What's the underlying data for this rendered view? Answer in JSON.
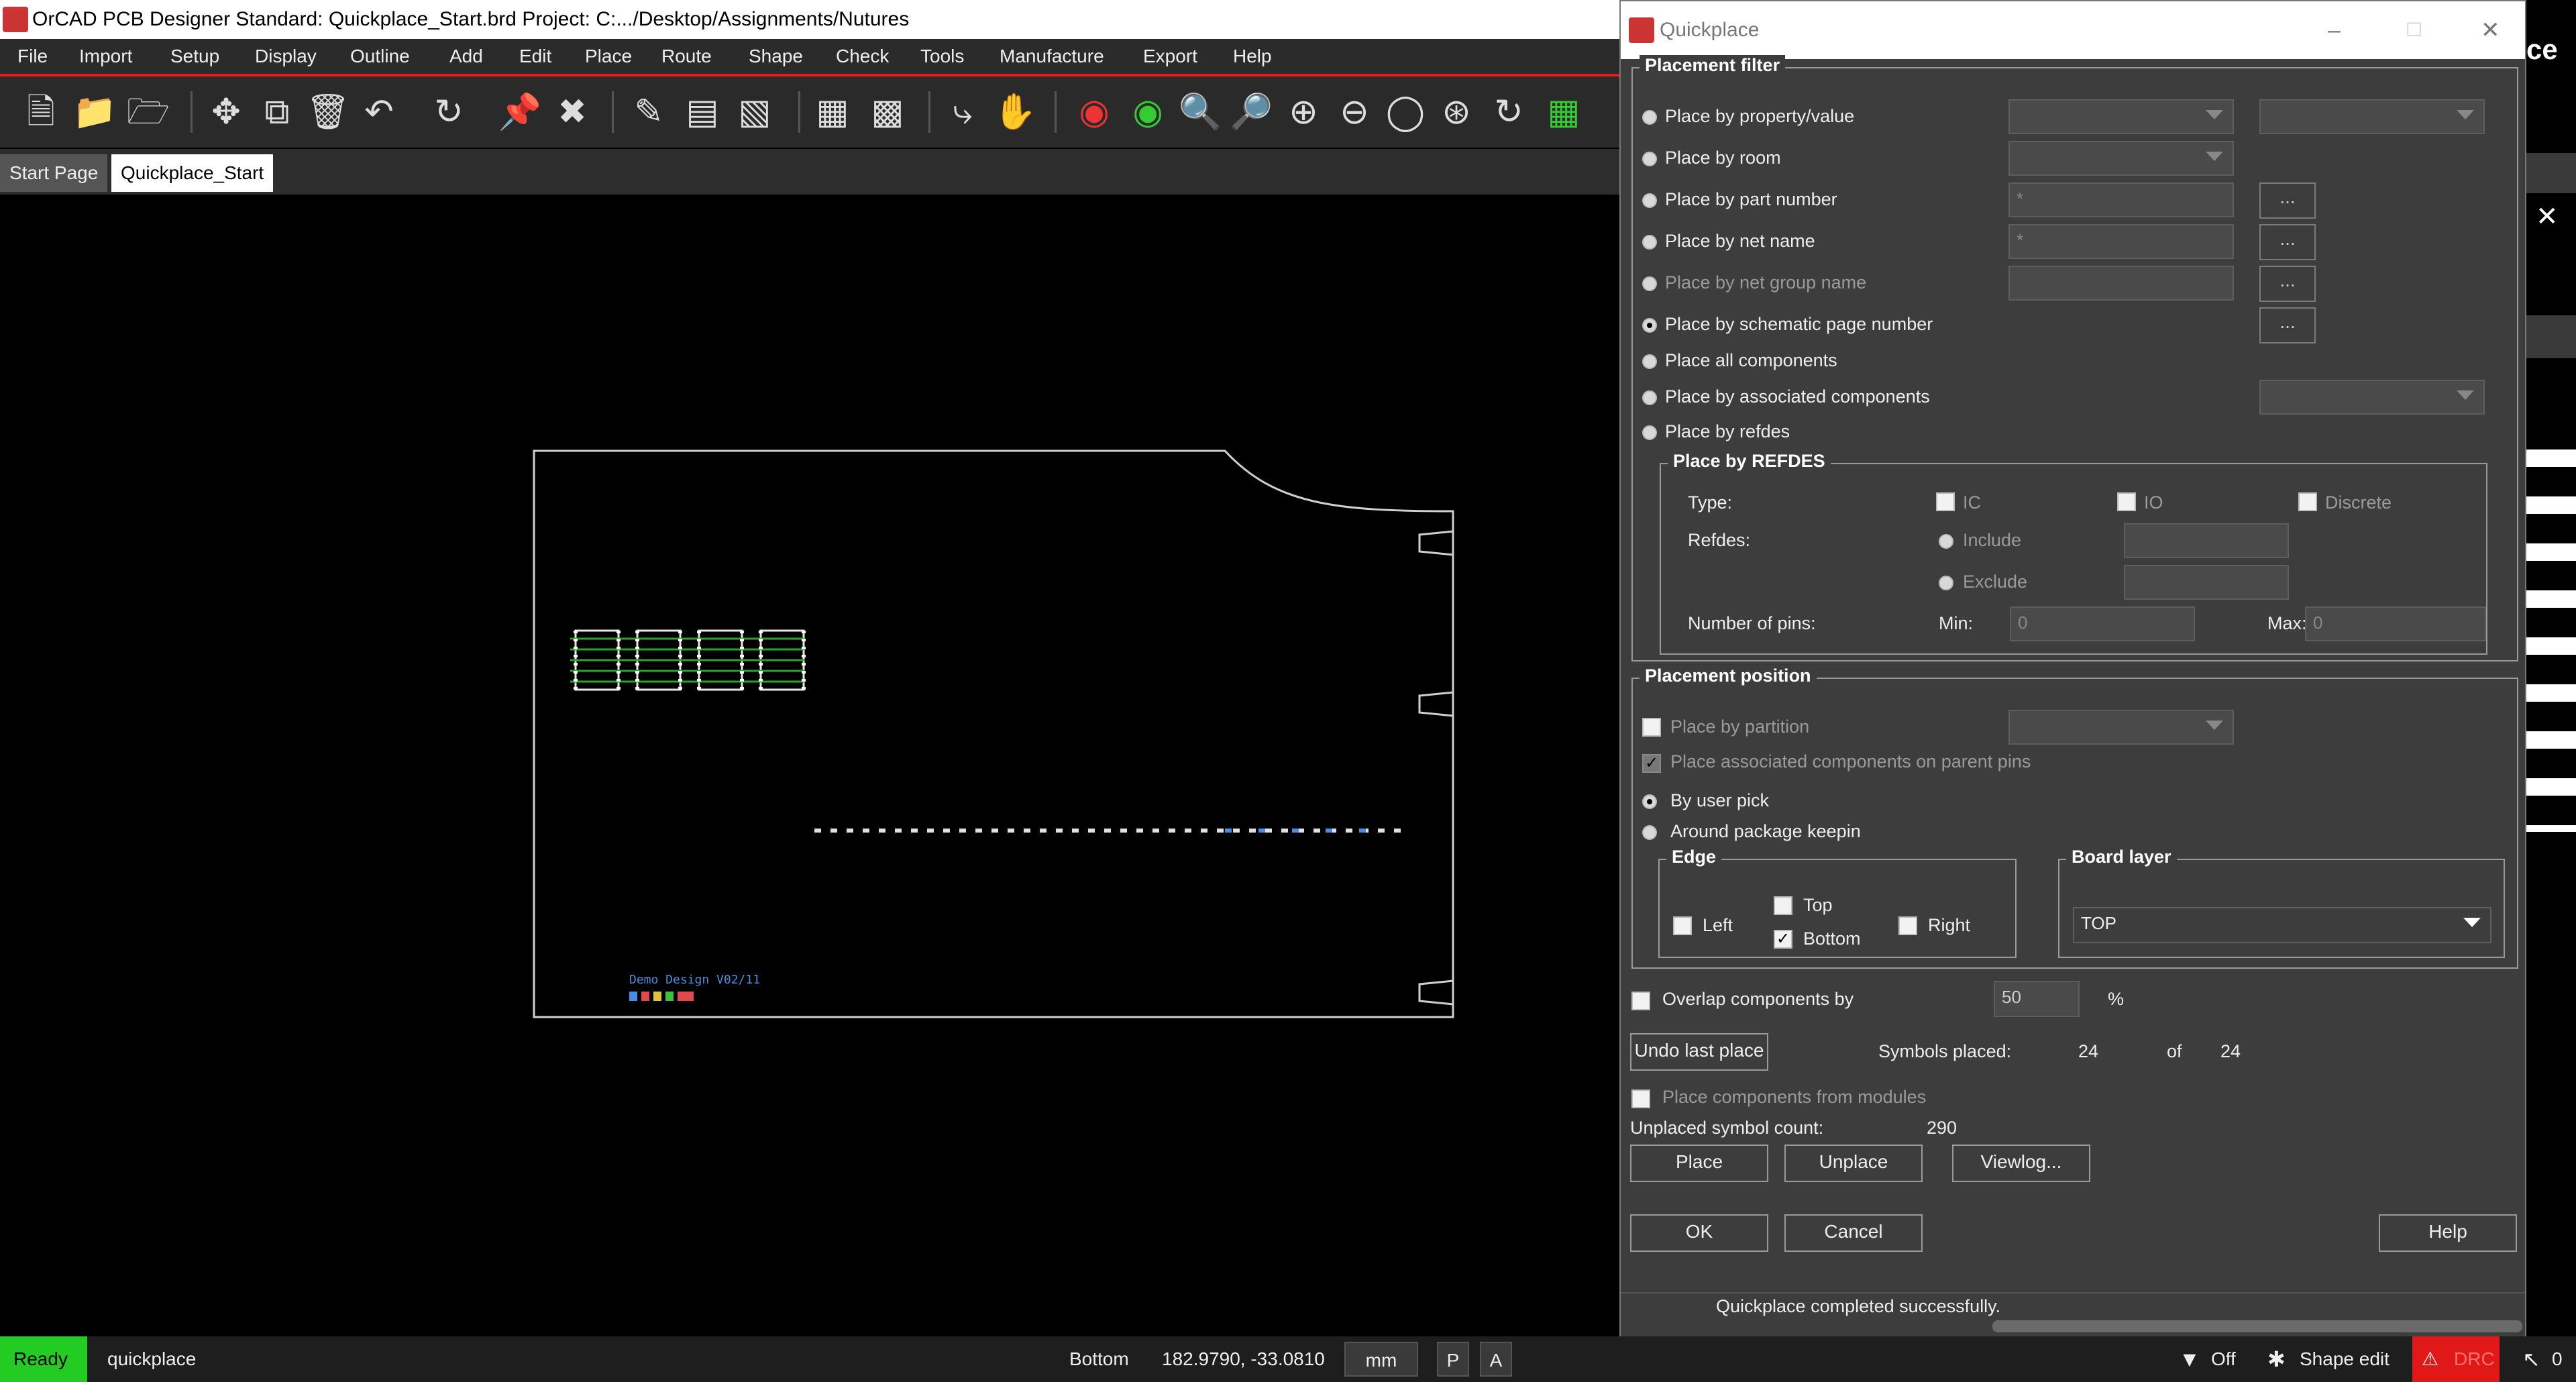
{
  "window": {
    "title": "OrCAD PCB Designer Standard: Quickplace_Start.brd  Project: C:.../Desktop/Assignments/Nutures"
  },
  "menu": [
    "File",
    "Import",
    "Setup",
    "Display",
    "Outline",
    "Add",
    "Edit",
    "Place",
    "Route",
    "Shape",
    "Check",
    "Tools",
    "Manufacture",
    "Export",
    "Help"
  ],
  "tabs": [
    "Start Page",
    "Quickplace_Start"
  ],
  "board": {
    "silk_text": "Demo Design V02/11"
  },
  "status": {
    "ready": "Ready",
    "command": "quickplace",
    "layer": "Bottom",
    "coords": "182.9790, -33.0810",
    "units": "mm",
    "p": "P",
    "a": "A",
    "filter": "Off",
    "mode": "Shape edit",
    "drc": "DRC",
    "sel_count": "0"
  },
  "dialog": {
    "title": "Quickplace",
    "placement_filter": {
      "label": "Placement filter",
      "opt_property": "Place by property/value",
      "opt_room": "Place by room",
      "opt_part": "Place by part number",
      "opt_net": "Place by net name",
      "opt_netgroup": "Place by net group name",
      "opt_schematic": "Place by schematic page number",
      "opt_all": "Place all components",
      "opt_assoc": "Place by associated components",
      "opt_refdes": "Place by refdes",
      "part_value": "*",
      "net_value": "*",
      "dots": "..."
    },
    "refdes_group": {
      "label": "Place by REFDES",
      "type_label": "Type:",
      "ic": "IC",
      "io": "IO",
      "discrete": "Discrete",
      "refdes_label": "Refdes:",
      "include": "Include",
      "exclude": "Exclude",
      "pins_label": "Number of pins:",
      "min_label": "Min:",
      "min_value": "0",
      "max_label": "Max:",
      "max_value": "0"
    },
    "placement_position": {
      "label": "Placement position",
      "by_partition": "Place by partition",
      "assoc_parent": "Place associated components on parent pins",
      "by_user_pick": "By user pick",
      "around_keepin": "Around package keepin"
    },
    "edge": {
      "label": "Edge",
      "left": "Left",
      "top": "Top",
      "bottom": "Bottom",
      "right": "Right"
    },
    "board_layer": {
      "label": "Board layer",
      "value": "TOP"
    },
    "overlap": {
      "label": "Overlap components by",
      "value": "50",
      "unit": "%"
    },
    "undo_button": "Undo last place",
    "symbols_placed_label": "Symbols placed:",
    "symbols_placed": "24",
    "of_label": "of",
    "symbols_total": "24",
    "from_modules": "Place components from modules",
    "unplaced_label": "Unplaced symbol count:",
    "unplaced_value": "290",
    "place_button": "Place",
    "unplace_button": "Unplace",
    "viewlog_button": "Viewlog...",
    "ok_button": "OK",
    "cancel_button": "Cancel",
    "help_button": "Help",
    "status_msg": "Quickplace completed successfully."
  },
  "colors": {
    "accent_red": "#e02020",
    "ready_green": "#22cc22",
    "drc_red": "#e01818"
  }
}
